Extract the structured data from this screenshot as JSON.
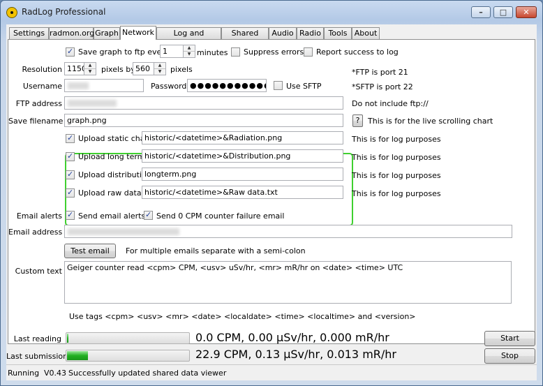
{
  "window": {
    "title": "RadLog Professional",
    "icon": "radiation-icon"
  },
  "tabs": [
    "Settings",
    "radmon.org",
    "Graph",
    "Network",
    "Log and Analysis",
    "Shared data",
    "Audio",
    "Radio",
    "Tools",
    "About"
  ],
  "active_tab": "Network",
  "ftp": {
    "save_graph_label": "Save graph to ftp every",
    "save_graph_checked": true,
    "minutes_value": "1",
    "minutes_label": "minutes",
    "suppress_errors_label": "Suppress errors",
    "suppress_errors_checked": false,
    "report_success_label": "Report success to log",
    "report_success_checked": false,
    "resolution_label": "Resolution",
    "res_x": "1150",
    "pixels_by_label": "pixels by",
    "res_y": "560",
    "pixels_label": "pixels",
    "ftp_port_note": "*FTP is port 21",
    "username_label": "Username",
    "password_label": "Password",
    "password_value": "●●●●●●●●●●●",
    "use_sftp_label": "Use SFTP",
    "use_sftp_checked": false,
    "sftp_port_note": "*SFTP is port 22",
    "address_label": "FTP address",
    "address_note": "Do not include ftp://",
    "save_filename_label": "Save filename",
    "save_filename_value": "graph.png",
    "help_button": "?",
    "live_chart_note": "This is for the live scrolling chart"
  },
  "uploads": [
    {
      "label": "Upload static chart",
      "checked": true,
      "value": "historic/<datetime>&Radiation.png",
      "note": "This is for log purposes"
    },
    {
      "label": "Upload long term",
      "checked": true,
      "value": "historic/<datetime>&Distribution.png",
      "note": "This is for log purposes"
    },
    {
      "label": "Upload distribution",
      "checked": true,
      "value": "longterm.png",
      "note": "This is for log purposes"
    },
    {
      "label": "Upload raw data",
      "checked": true,
      "value": "historic/<datetime>&Raw data.txt",
      "note": "This is for log purposes"
    }
  ],
  "email": {
    "alerts_label": "Email alerts",
    "send_alerts_label": "Send email alerts",
    "send_alerts_checked": true,
    "zero_cpm_label": "Send 0 CPM counter failure email",
    "zero_cpm_checked": true,
    "address_label": "Email address",
    "test_button": "Test email",
    "multi_note": "For multiple emails separate with a semi-colon",
    "custom_text_label": "Custom text",
    "custom_text_value": "Geiger counter read <cpm> CPM, <usv> uSv/hr, <mr> mR/hr on <date> <time> UTC",
    "tags_note": "Use tags <cpm> <usv> <mr> <date> <localdate> <time> <localtime> and <version>"
  },
  "readings": {
    "last_reading_label": "Last reading",
    "last_reading_value": "0.0 CPM, 0.00 µSv/hr, 0.000 mR/hr",
    "last_reading_progress": 0.01,
    "last_submission_label": "Last submission",
    "last_submission_value": "22.9 CPM, 0.13 µSv/hr, 0.013 mR/hr",
    "last_submission_progress": 0.17,
    "start_button": "Start",
    "stop_button": "Stop"
  },
  "status": {
    "state": "Running",
    "version": "V0.43",
    "message": "Successfully updated shared data viewer"
  }
}
